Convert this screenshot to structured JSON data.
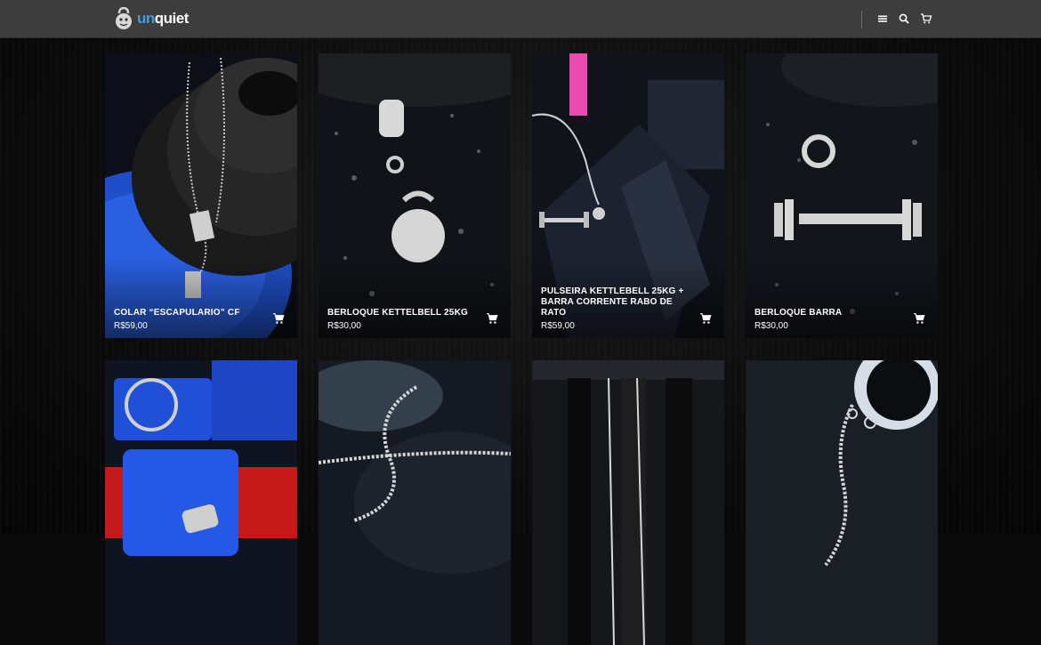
{
  "brand": {
    "prefix": "un",
    "rest": "quiet"
  },
  "header": {
    "icons": [
      "menu-icon",
      "search-icon",
      "cart-icon"
    ]
  },
  "products": [
    {
      "title": "COLAR “ESCAPULARIO” CF",
      "price": "R$59,00",
      "photo": "necklace-on-plates"
    },
    {
      "title": "BERLOQUE KETTELBELL 25KG",
      "price": "R$30,00",
      "photo": "kettlebell-charm"
    },
    {
      "title": "PULSEIRA KETTLEBELL 25KG + BARRA CORRENTE RABO DE RATO",
      "price": "R$59,00",
      "photo": "bracelet-on-dumbbell"
    },
    {
      "title": "BERLOQUE BARRA",
      "price": "R$30,00",
      "photo": "barbell-charm"
    },
    {
      "title": "",
      "price": "",
      "photo": "keychain-on-clips"
    },
    {
      "title": "",
      "price": "",
      "photo": "ball-chain-bracelet"
    },
    {
      "title": "",
      "price": "",
      "photo": "chain-on-plates"
    },
    {
      "title": "",
      "price": "",
      "photo": "ball-chain-on-plate"
    }
  ],
  "colors": {
    "header": "#3d3d3d",
    "accent": "#3b9fe0",
    "background": "#0a0a0a"
  }
}
